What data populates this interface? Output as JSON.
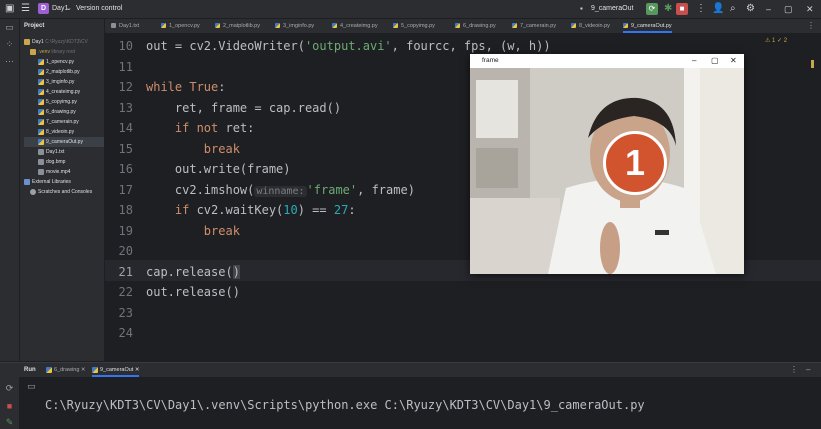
{
  "titlebar": {
    "project_name": "Day1",
    "project_initial": "D",
    "vcs_label": "Version control",
    "run_config": "9_cameraOut"
  },
  "project_panel": {
    "title": "Project",
    "tree": [
      {
        "label": "Day1",
        "suffix": "C:\\Ryuzy\\KDT3\\CV",
        "type": "folder"
      },
      {
        "label": ".venv",
        "suffix": "library root",
        "type": "folder"
      },
      {
        "label": "1_opencv.py",
        "type": "py"
      },
      {
        "label": "2_matplotlib.py",
        "type": "py"
      },
      {
        "label": "3_imginfo.py",
        "type": "py"
      },
      {
        "label": "4_createimg.py",
        "type": "py"
      },
      {
        "label": "5_copyimg.py",
        "type": "py"
      },
      {
        "label": "6_drawing.py",
        "type": "py"
      },
      {
        "label": "7_camerain.py",
        "type": "py"
      },
      {
        "label": "8_videoin.py",
        "type": "py"
      },
      {
        "label": "9_cameraOut.py",
        "type": "py"
      },
      {
        "label": "Day1.txt",
        "type": "file"
      },
      {
        "label": "dog.bmp",
        "type": "file"
      },
      {
        "label": "movie.mp4",
        "type": "file"
      },
      {
        "label": "External Libraries",
        "type": "lib"
      },
      {
        "label": "Scratches and Consoles",
        "type": "scratch"
      }
    ]
  },
  "tabs": [
    {
      "label": "Day1.txt"
    },
    {
      "label": "1_opencv.py"
    },
    {
      "label": "2_matplotlib.py"
    },
    {
      "label": "3_imginfo.py"
    },
    {
      "label": "4_createimg.py"
    },
    {
      "label": "5_copyimg.py"
    },
    {
      "label": "6_drawing.py"
    },
    {
      "label": "7_camerain.py"
    },
    {
      "label": "8_videoin.py"
    },
    {
      "label": "9_cameraOut.py"
    }
  ],
  "editor": {
    "line_numbers": [
      "10",
      "11",
      "12",
      "13",
      "14",
      "15",
      "16",
      "17",
      "18",
      "19",
      "20",
      "21",
      "22",
      "23",
      "24"
    ],
    "code": {
      "l10_a": "out = cv2.VideoWriter(",
      "l10_s": "'output.avi'",
      "l10_b": ", fourcc, fps, (w, h))",
      "l12_kw": "while True",
      "l12_b": ":",
      "l13": "    ret, frame = cap.read()",
      "l14_kw": "if not",
      "l14_b": " ret:",
      "l15_kw": "break",
      "l16": "    out.write(frame)",
      "l17_a": "    cv2.imshow(",
      "l17_hint": "winname:",
      "l17_s": "'frame'",
      "l17_b": ", frame)",
      "l18_kw": "if",
      "l18_a": " cv2.waitKey(",
      "l18_n1": "10",
      "l18_b": ") == ",
      "l18_n2": "27",
      "l18_c": ":",
      "l19_kw": "break",
      "l21_a": "cap.release(",
      "l21_b": ")",
      "l22": "out.release()"
    },
    "status_text": "⚠ 1 ✓ 2"
  },
  "frame_window": {
    "title": "frame",
    "badge_number": "1"
  },
  "run_panel": {
    "label": "Run",
    "tabs": [
      "6_drawing",
      "9_cameraOut"
    ],
    "console_line": "C:\\Ryuzy\\KDT3\\CV\\Day1\\.venv\\Scripts\\python.exe C:\\Ryuzy\\KDT3\\CV\\Day1\\9_cameraOut.py"
  },
  "colors": {
    "accent": "#3574f0",
    "keyword": "#cf8e6d",
    "string": "#6aab73",
    "number": "#2aacb8"
  }
}
